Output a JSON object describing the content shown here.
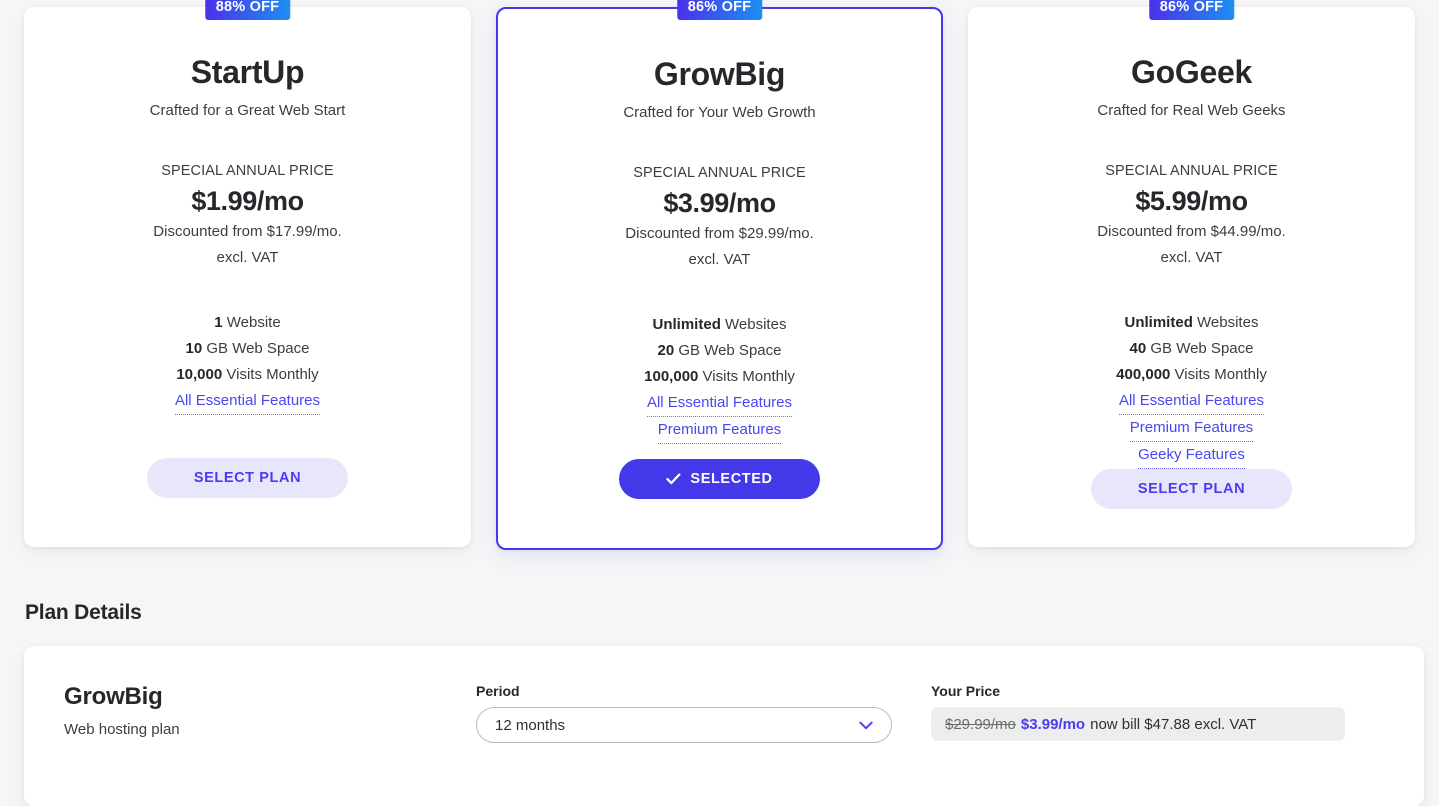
{
  "theme": {
    "page_background": "#f6f6f7",
    "card_background": "#ffffff",
    "accent": "#4339e8",
    "accent_light": "#e8e6fb",
    "link": "#4a47f0",
    "badge_gradient_from": "#4a31e8",
    "badge_gradient_to": "#1d90f2"
  },
  "plans": [
    {
      "badge": "88% OFF",
      "name": "StartUp",
      "tagline": "Crafted for a Great Web Start",
      "price_label": "SPECIAL ANNUAL PRICE",
      "price_main": "$1.99/mo",
      "price_discounted": "Discounted from $17.99/mo.",
      "price_vat": "excl. VAT",
      "features": [
        {
          "value": "1",
          "text": " Website"
        },
        {
          "value": "10",
          "text": " GB Web Space"
        },
        {
          "value": "10,000",
          "text": " Visits Monthly"
        }
      ],
      "links": [
        "All Essential Features"
      ],
      "cta": "SELECT PLAN",
      "selected": false
    },
    {
      "badge": "86% OFF",
      "name": "GrowBig",
      "tagline": "Crafted for Your Web Growth",
      "price_label": "SPECIAL ANNUAL PRICE",
      "price_main": "$3.99/mo",
      "price_discounted": "Discounted from $29.99/mo.",
      "price_vat": "excl. VAT",
      "features": [
        {
          "value": "Unlimited",
          "text": " Websites"
        },
        {
          "value": "20",
          "text": " GB Web Space"
        },
        {
          "value": "100,000",
          "text": " Visits Monthly"
        }
      ],
      "links": [
        "All Essential Features",
        "Premium Features"
      ],
      "cta": "SELECTED",
      "selected": true
    },
    {
      "badge": "86% OFF",
      "name": "GoGeek",
      "tagline": "Crafted for Real Web Geeks",
      "price_label": "SPECIAL ANNUAL PRICE",
      "price_main": "$5.99/mo",
      "price_discounted": "Discounted from $44.99/mo.",
      "price_vat": "excl. VAT",
      "features": [
        {
          "value": "Unlimited",
          "text": " Websites"
        },
        {
          "value": "40",
          "text": " GB Web Space"
        },
        {
          "value": "400,000",
          "text": " Visits Monthly"
        }
      ],
      "links": [
        "All Essential Features",
        "Premium Features",
        "Geeky Features"
      ],
      "cta": "SELECT PLAN",
      "selected": false
    }
  ],
  "details": {
    "heading": "Plan Details",
    "plan_name": "GrowBig",
    "plan_subtitle": "Web hosting plan",
    "period_label": "Period",
    "period_value": "12 months",
    "period_options": [
      "12 months"
    ],
    "price_label": "Your Price",
    "price_old": "$29.99/mo",
    "price_new": "$3.99/mo",
    "price_rest": "now bill $47.88 excl. VAT"
  }
}
